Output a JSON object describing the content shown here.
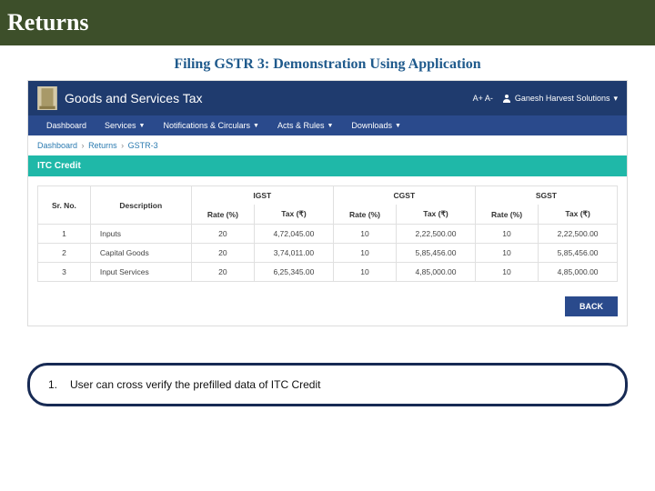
{
  "slide": {
    "title": "Returns",
    "subtitle": "Filing GSTR 3: Demonstration Using Application"
  },
  "gst_header": {
    "app_title": "Goods and Services Tax",
    "font_large": "A+",
    "font_small": "A-",
    "user_name": "Ganesh Harvest Solutions",
    "user_icon": "user-icon",
    "user_chevron": "▾"
  },
  "nav": {
    "items": [
      {
        "label": "Dashboard",
        "has_dropdown": false
      },
      {
        "label": "Services",
        "has_dropdown": true
      },
      {
        "label": "Notifications & Circulars",
        "has_dropdown": true
      },
      {
        "label": "Acts & Rules",
        "has_dropdown": true
      },
      {
        "label": "Downloads",
        "has_dropdown": true
      }
    ]
  },
  "breadcrumb": {
    "items": [
      "Dashboard",
      "Returns",
      "GSTR-3"
    ],
    "separator": "›"
  },
  "section": {
    "banner": "ITC Credit"
  },
  "table": {
    "headers_top": [
      "Sr. No.",
      "Description",
      "IGST",
      "CGST",
      "SGST"
    ],
    "headers_sub": [
      "Rate (%)",
      "Tax (₹)",
      "Rate (%)",
      "Tax (₹)",
      "Rate (%)",
      "Tax (₹)"
    ],
    "rows": [
      {
        "sr": "1",
        "desc": "Inputs",
        "igst_rate": "20",
        "igst_tax": "4,72,045.00",
        "cgst_rate": "10",
        "cgst_tax": "2,22,500.00",
        "sgst_rate": "10",
        "sgst_tax": "2,22,500.00"
      },
      {
        "sr": "2",
        "desc": "Capital Goods",
        "igst_rate": "20",
        "igst_tax": "3,74,011.00",
        "cgst_rate": "10",
        "cgst_tax": "5,85,456.00",
        "sgst_rate": "10",
        "sgst_tax": "5,85,456.00"
      },
      {
        "sr": "3",
        "desc": "Input Services",
        "igst_rate": "20",
        "igst_tax": "6,25,345.00",
        "cgst_rate": "10",
        "cgst_tax": "4,85,000.00",
        "sgst_rate": "10",
        "sgst_tax": "4,85,000.00"
      }
    ]
  },
  "buttons": {
    "back": "BACK"
  },
  "callout": {
    "number": "1.",
    "text": "User can cross verify the prefilled data of ITC Credit"
  }
}
